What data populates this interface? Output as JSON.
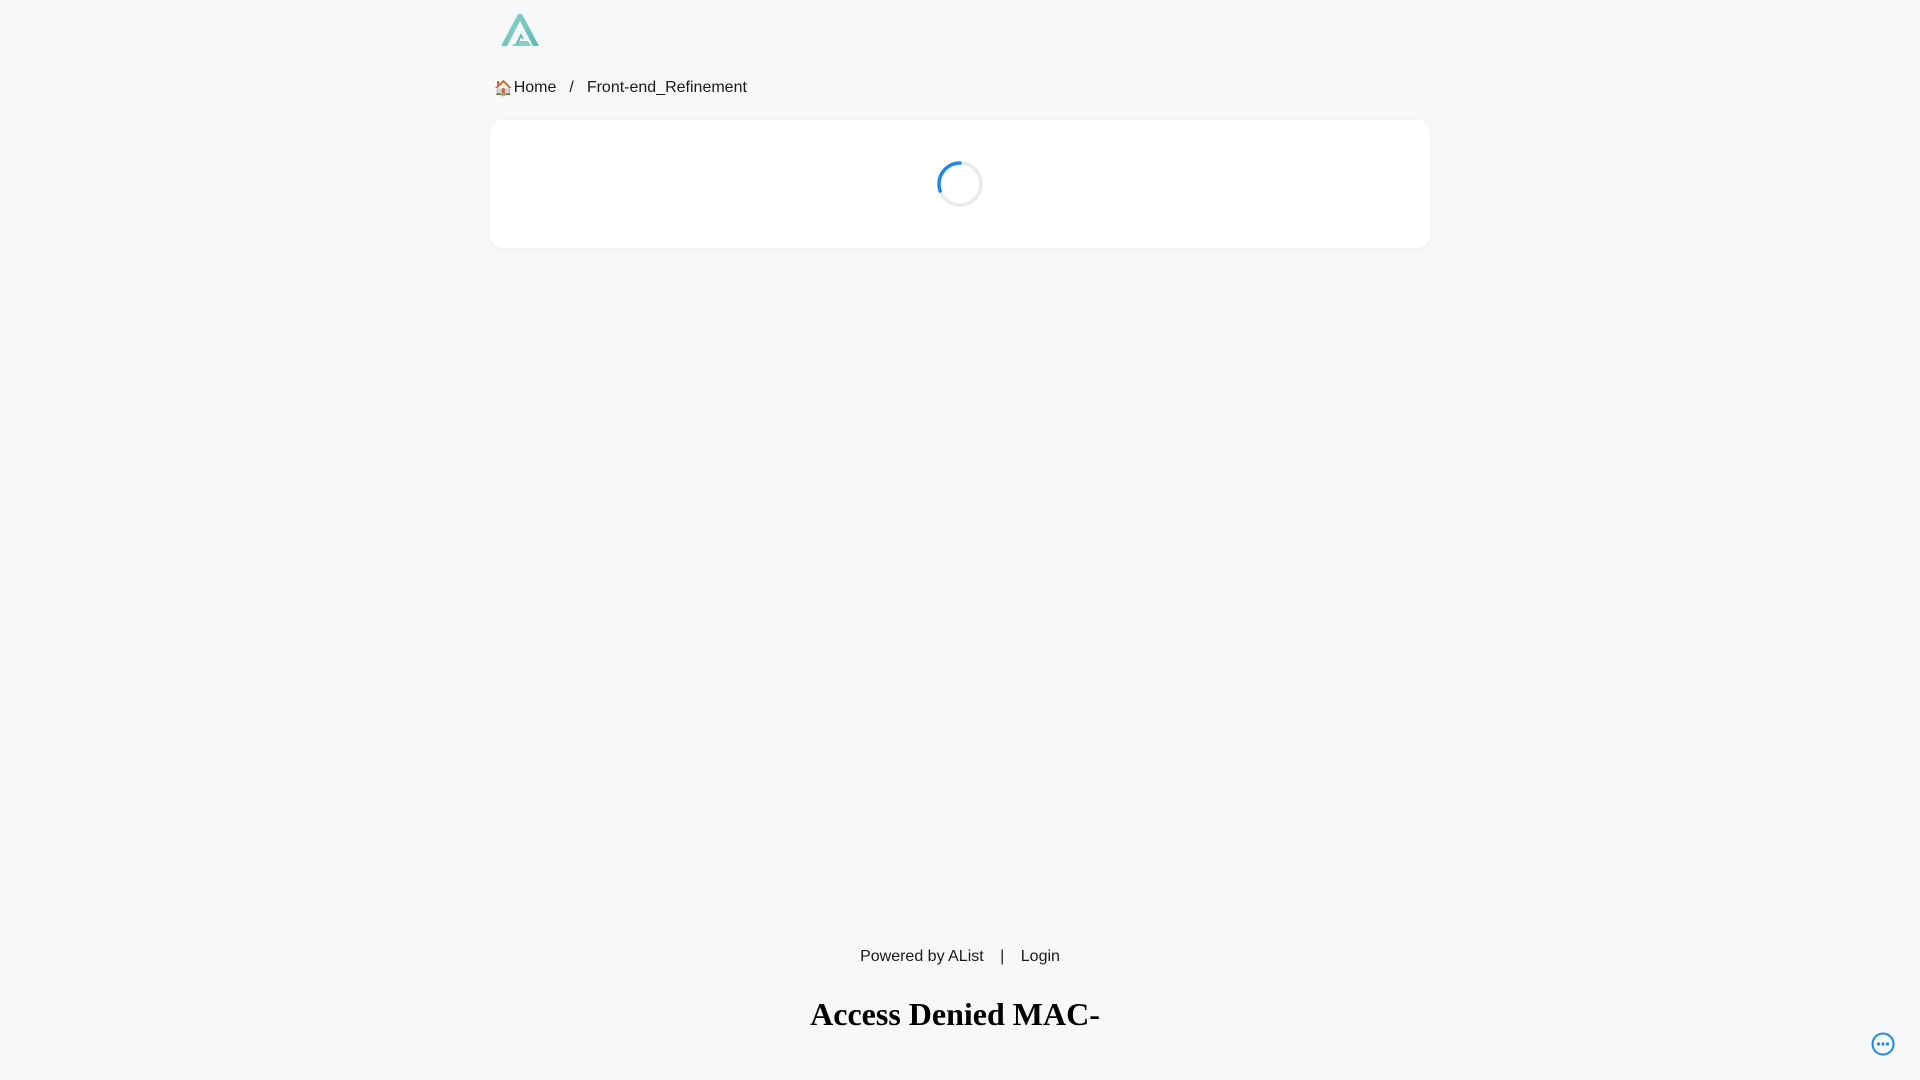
{
  "header": {
    "logo": "alist-logo",
    "logo_colors": [
      "#70c6be",
      "#1ba0d8"
    ]
  },
  "breadcrumb": {
    "home_icon": "🏠",
    "home_label": "Home",
    "separator": "/",
    "current_label": "Front-end_Refinement"
  },
  "content": {
    "state": "loading",
    "spinner_icon": "spinner-icon",
    "accent_color": "#1e88e5"
  },
  "footer": {
    "powered_by": "Powered by AList",
    "separator": "|",
    "login_label": "Login"
  },
  "notice": {
    "text": "Access Denied MAC-"
  },
  "floating": {
    "more_icon": "more-options-icon",
    "color": "#1e88e5"
  }
}
